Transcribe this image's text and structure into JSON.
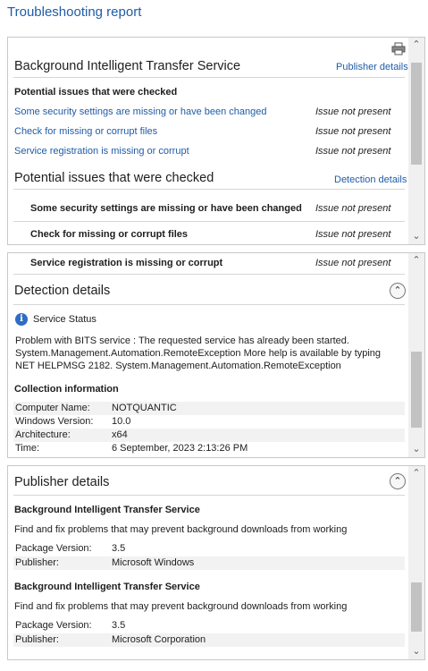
{
  "title": "Troubleshooting report",
  "panel1": {
    "service_title": "Background Intelligent Transfer Service",
    "publisher_link": "Publisher details",
    "checked_heading": "Potential issues that were checked",
    "issues": [
      {
        "label": "Some security settings are missing or have been changed",
        "status": "Issue not present"
      },
      {
        "label": "Check for missing or corrupt files",
        "status": "Issue not present"
      },
      {
        "label": "Service registration is missing or corrupt",
        "status": "Issue not present"
      }
    ],
    "section_heading": "Potential issues that were checked",
    "detection_link": "Detection details",
    "detail_issues": [
      {
        "label": "Some security settings are missing or have been changed",
        "status": "Issue not present"
      },
      {
        "label": "Check for missing or corrupt files",
        "status": "Issue not present"
      }
    ]
  },
  "panel2": {
    "issue": {
      "label": "Service registration is missing or corrupt",
      "status": "Issue not present"
    },
    "detection_heading": "Detection details",
    "service_status_label": "Service Status",
    "message": "Problem with BITS service : The requested service has already been started. System.Management.Automation.RemoteException More help is available by typing NET HELPMSG 2182. System.Management.Automation.RemoteException",
    "collection_heading": "Collection information",
    "collection": [
      {
        "key": "Computer Name:",
        "value": "NOTQUANTIC"
      },
      {
        "key": "Windows Version:",
        "value": "10.0"
      },
      {
        "key": "Architecture:",
        "value": "x64"
      },
      {
        "key": "Time:",
        "value": "6 September, 2023 2:13:26 PM"
      }
    ]
  },
  "panel3": {
    "heading": "Publisher details",
    "publishers": [
      {
        "name": "Background Intelligent Transfer Service",
        "description": "Find and fix problems that may prevent background downloads from working",
        "fields": [
          {
            "key": "Package Version:",
            "value": "3.5"
          },
          {
            "key": "Publisher:",
            "value": "Microsoft Windows"
          }
        ]
      },
      {
        "name": "Background Intelligent Transfer Service",
        "description": "Find and fix problems that may prevent background downloads from working",
        "fields": [
          {
            "key": "Package Version:",
            "value": "3.5"
          },
          {
            "key": "Publisher:",
            "value": "Microsoft Corporation"
          }
        ]
      }
    ]
  },
  "icons": {
    "printer": "printer-icon",
    "info": "info-icon",
    "collapse": "collapse-icon",
    "scroll_up": "scroll-up-icon",
    "scroll_down": "scroll-down-icon"
  },
  "colors": {
    "link": "#1f5ca8",
    "info_icon": "#2f6cc4"
  }
}
